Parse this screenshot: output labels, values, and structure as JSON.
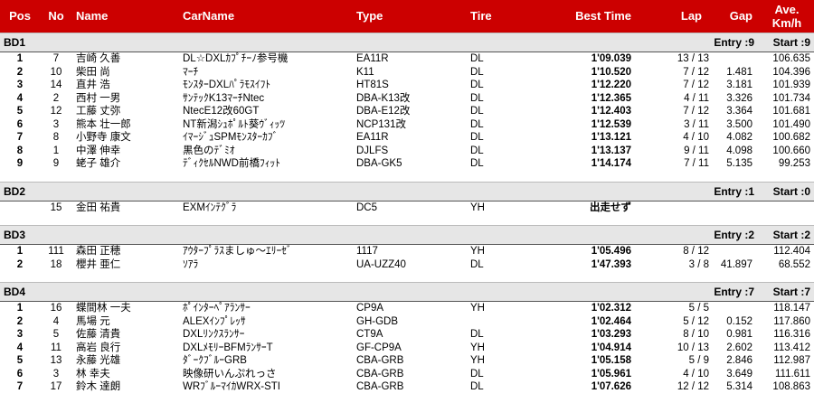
{
  "headers": {
    "pos": "Pos",
    "no": "No",
    "name": "Name",
    "car": "CarName",
    "type": "Type",
    "tire": "Tire",
    "best": "Best Time",
    "lap": "Lap",
    "gap": "Gap",
    "ave1": "Ave.",
    "ave2": "Km/h"
  },
  "classes": [
    {
      "name": "BD1",
      "entry": "Entry :9",
      "start": "Start :9",
      "rows": [
        {
          "pos": "1",
          "no": "7",
          "name": "吉崎 久善",
          "car": "DL☆DXLｶﾌﾟﾁｰﾉ参号機",
          "type": "EA11R",
          "tire": "DL",
          "best": "1'09.039",
          "lap": "13 / 13",
          "gap": "",
          "ave": "106.635"
        },
        {
          "pos": "2",
          "no": "10",
          "name": "柴田 尚",
          "car": "ﾏｰﾁ",
          "type": "K11",
          "tire": "DL",
          "best": "1'10.520",
          "lap": "7 / 12",
          "gap": "1.481",
          "ave": "104.396"
        },
        {
          "pos": "3",
          "no": "14",
          "name": "直井 浩",
          "car": "ﾓﾝｽﾀｰDXLﾊﾟﾗﾓｽｲﾌﾄ",
          "type": "HT81S",
          "tire": "DL",
          "best": "1'12.220",
          "lap": "7 / 12",
          "gap": "3.181",
          "ave": "101.939"
        },
        {
          "pos": "4",
          "no": "2",
          "name": "西村 一男",
          "car": "ｻﾝﾃｯｸK13ﾏｰﾁNtec",
          "type": "DBA-K13改",
          "tire": "DL",
          "best": "1'12.365",
          "lap": "4 / 11",
          "gap": "3.326",
          "ave": "101.734"
        },
        {
          "pos": "5",
          "no": "12",
          "name": "工藤 丈弥",
          "car": "NtecE12改60GT",
          "type": "DBA-E12改",
          "tire": "DL",
          "best": "1'12.403",
          "lap": "7 / 12",
          "gap": "3.364",
          "ave": "101.681"
        },
        {
          "pos": "6",
          "no": "3",
          "name": "熊本 壮一郎",
          "car": "NT新潟ｼｭﾎﾟﾙﾄ葵ｳﾞｨｯﾂ",
          "type": "NCP131改",
          "tire": "DL",
          "best": "1'12.539",
          "lap": "3 / 11",
          "gap": "3.500",
          "ave": "101.490"
        },
        {
          "pos": "7",
          "no": "8",
          "name": "小野寺 康文",
          "car": "ｲﾏｰｼﾞｭSPMﾓﾝｽﾀｰｶﾌﾞ",
          "type": "EA11R",
          "tire": "DL",
          "best": "1'13.121",
          "lap": "4 / 10",
          "gap": "4.082",
          "ave": "100.682"
        },
        {
          "pos": "8",
          "no": "1",
          "name": "中澤 伸幸",
          "car": "黒色のﾃﾞﾐｵ",
          "type": "DJLFS",
          "tire": "DL",
          "best": "1'13.137",
          "lap": "9 / 11",
          "gap": "4.098",
          "ave": "100.660"
        },
        {
          "pos": "9",
          "no": "9",
          "name": "蛯子 雄介",
          "car": "ﾃﾞｨｸｾﾙNWD前橋ﾌｨｯﾄ",
          "type": "DBA-GK5",
          "tire": "DL",
          "best": "1'14.174",
          "lap": "7 / 11",
          "gap": "5.135",
          "ave": "99.253"
        }
      ]
    },
    {
      "name": "BD2",
      "entry": "Entry :1",
      "start": "Start :0",
      "rows": [
        {
          "pos": "",
          "no": "15",
          "name": "金田 祐貴",
          "car": "EXMｲﾝﾃｸﾞﾗ",
          "type": "DC5",
          "tire": "YH",
          "best": "出走せず",
          "lap": "",
          "gap": "",
          "ave": ""
        }
      ]
    },
    {
      "name": "BD3",
      "entry": "Entry :2",
      "start": "Start :2",
      "rows": [
        {
          "pos": "1",
          "no": "111",
          "name": "森田 正穂",
          "car": "ｱｳﾀｰﾌﾟﾗｽましゅ～ｴﾘｰｾﾞ",
          "type": "1117",
          "tire": "YH",
          "best": "1'05.496",
          "lap": "8 / 12",
          "gap": "",
          "ave": "112.404"
        },
        {
          "pos": "2",
          "no": "18",
          "name": "櫻井 亜仁",
          "car": "ｿｱﾗ",
          "type": "UA-UZZ40",
          "tire": "DL",
          "best": "1'47.393",
          "lap": "3 / 8",
          "gap": "41.897",
          "ave": "68.552"
        }
      ]
    },
    {
      "name": "BD4",
      "entry": "Entry :7",
      "start": "Start :7",
      "rows": [
        {
          "pos": "1",
          "no": "16",
          "name": "蝶間林 一夫",
          "car": "ﾎﾟｲﾝﾀｰﾍﾟｱﾗﾝｻｰ",
          "type": "CP9A",
          "tire": "YH",
          "best": "1'02.312",
          "lap": "5 / 5",
          "gap": "",
          "ave": "118.147"
        },
        {
          "pos": "2",
          "no": "4",
          "name": "馬場 元",
          "car": "ALEXｲﾝﾌﾟﾚｯｻ",
          "type": "GH-GDB",
          "tire": "",
          "best": "1'02.464",
          "lap": "5 / 12",
          "gap": "0.152",
          "ave": "117.860"
        },
        {
          "pos": "3",
          "no": "5",
          "name": "佐藤 清貴",
          "car": "DXLﾘﾝｸｽﾗﾝｻｰ",
          "type": "CT9A",
          "tire": "DL",
          "best": "1'03.293",
          "lap": "8 / 10",
          "gap": "0.981",
          "ave": "116.316"
        },
        {
          "pos": "4",
          "no": "11",
          "name": "高岩 良行",
          "car": "DXLﾒﾓﾘｰBFMﾗﾝｻｰT",
          "type": "GF-CP9A",
          "tire": "YH",
          "best": "1'04.914",
          "lap": "10 / 13",
          "gap": "2.602",
          "ave": "113.412"
        },
        {
          "pos": "5",
          "no": "13",
          "name": "永藤 光雄",
          "car": "ﾀﾞｰｸﾌﾞﾙｰGRB",
          "type": "CBA-GRB",
          "tire": "YH",
          "best": "1'05.158",
          "lap": "5 / 9",
          "gap": "2.846",
          "ave": "112.987"
        },
        {
          "pos": "6",
          "no": "3",
          "name": "林 幸夫",
          "car": "映像研いんぷれっさ",
          "type": "CBA-GRB",
          "tire": "DL",
          "best": "1'05.961",
          "lap": "4 / 10",
          "gap": "3.649",
          "ave": "111.611"
        },
        {
          "pos": "7",
          "no": "17",
          "name": "鈴木 達朗",
          "car": "WRﾌﾞﾙｰﾏｲｶWRX-STI",
          "type": "CBA-GRB",
          "tire": "DL",
          "best": "1'07.626",
          "lap": "12 / 12",
          "gap": "5.314",
          "ave": "108.863"
        }
      ]
    }
  ]
}
